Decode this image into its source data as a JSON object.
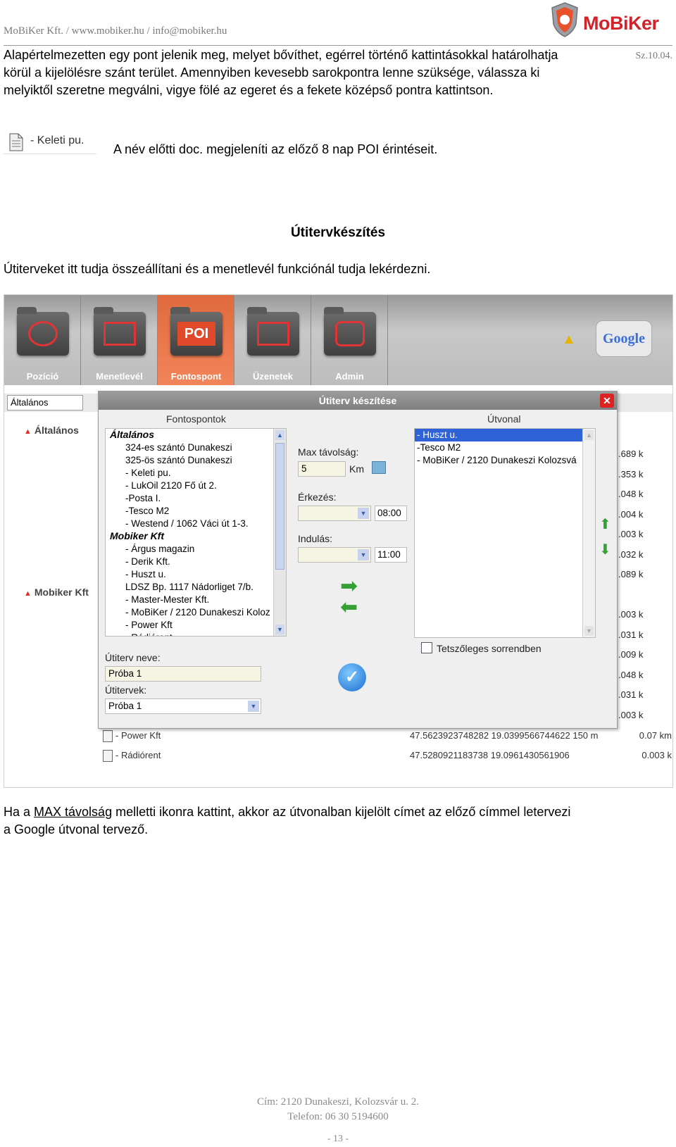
{
  "header": {
    "contact": "MoBiKer Kft.  / www.mobiker.hu / info@mobiker.hu",
    "logo_text": "MoBiKer",
    "date": "Sz.10.04."
  },
  "intro": {
    "line1": "Alapértelmezetten egy pont jelenik meg, melyet bővíthet, egérrel történő kattintásokkal határolhatja",
    "line2": "körül a kijelölésre szánt terület. Amennyiben kevesebb sarokpontra lenne szüksége, válassza ki",
    "line3": "melyiktől szeretne megválni, vigye fölé az egeret és a fekete középső pontra kattintson."
  },
  "doc_item": {
    "label": "- Keleti pu.",
    "description": "A név előtti doc. megjeleníti az előző 8 nap POI érintéseit."
  },
  "section": {
    "title": "Útitervkészítés",
    "text": "Útiterveket itt tudja összeállítani és a menetlevél funkciónál tudja lekérdezni."
  },
  "app": {
    "nav": [
      "Pozíció",
      "Menetlevél",
      "Fontospont",
      "Üzenetek",
      "Admin"
    ],
    "active_nav": "Fontospont",
    "maps_badge": "Google",
    "filter_value": "Általános",
    "groups": [
      "Általános",
      "Mobiker Kft"
    ],
    "distances": [
      ".689 k",
      ".353 k",
      ".048 k",
      ".004 k",
      ".003 k",
      ".032 k",
      ".089 k",
      "",
      ".003 k",
      ".031 k",
      ".009 k",
      ".048 k",
      ".031 k",
      ".003 k"
    ],
    "rows": [
      {
        "name": "- Power Kft",
        "coords": "47.5623923748282 19.0399566744622 150 m",
        "dist": "0.07 km"
      },
      {
        "name": "- Rádiórent",
        "coords": "47.5280921183738 19.0961430561906",
        "dist": "0.003 k"
      }
    ]
  },
  "dialog": {
    "title": "Útiterv készítése",
    "poi_header": "Fontospontok",
    "route_header": "Útvonal",
    "poi_list": [
      {
        "text": "Általános",
        "group": true
      },
      {
        "text": "324-es szántó Dunakeszi",
        "group": false
      },
      {
        "text": "325-ös szántó Dunakeszi",
        "group": false
      },
      {
        "text": "- Keleti pu.",
        "group": false
      },
      {
        "text": "- LukOil 2120 Fő út 2.",
        "group": false
      },
      {
        "text": "-Posta I.",
        "group": false
      },
      {
        "text": "-Tesco M2",
        "group": false
      },
      {
        "text": "- Westend / 1062 Váci út 1-3.",
        "group": false
      },
      {
        "text": "Mobiker Kft",
        "group": true
      },
      {
        "text": "- Árgus magazin",
        "group": false
      },
      {
        "text": "- Derik Kft.",
        "group": false
      },
      {
        "text": "- Huszt u.",
        "group": false
      },
      {
        "text": "LDSZ Bp. 1117 Nádorliget 7/b.",
        "group": false
      },
      {
        "text": "- Master-Mester Kft.",
        "group": false
      },
      {
        "text": "- MoBiKer / 2120 Dunakeszi Koloz",
        "group": false
      },
      {
        "text": "- Power Kft",
        "group": false
      },
      {
        "text": "- Rádiórent",
        "group": false
      }
    ],
    "route_list": [
      "- Huszt u.",
      "-Tesco M2",
      "- MoBiKer / 2120 Dunakeszi Kolozsvá"
    ],
    "route_selected_index": 0,
    "max_dist_label": "Max távolság:",
    "max_dist_value": "5",
    "max_dist_unit": "Km",
    "arrival_label": "Érkezés:",
    "arrival_time": "08:00",
    "departure_label": "Indulás:",
    "departure_time": "11:00",
    "any_order_label": "Tetszőleges sorrendben",
    "route_name_label": "Útiterv neve:",
    "route_name_value": "Próba 1",
    "routes_label": "Útitervek:",
    "routes_value": "Próba 1"
  },
  "closing": {
    "prefix": "Ha a ",
    "link": "MAX távolság",
    "rest1": " melletti ikonra kattint, akkor az útvonalban kijelölt címet az előző címmel letervezi",
    "rest2": "a Google útvonal tervező."
  },
  "footer": {
    "address": "Cím: 2120 Dunakeszi, Kolozsvár u. 2.",
    "phone": "Telefon: 06 30 5194600",
    "page": "- 13 -"
  }
}
